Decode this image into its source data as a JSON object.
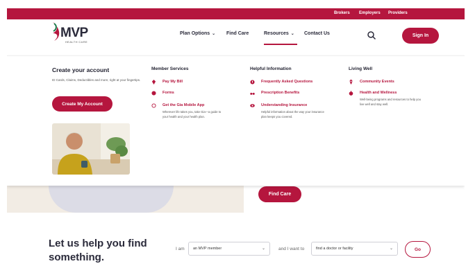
{
  "utility_nav": [
    "Brokers",
    "Employers",
    "Providers"
  ],
  "brand": {
    "name": "MVP",
    "tagline": "HEALTH CARE",
    "accent": "#b5163e"
  },
  "main_nav": [
    {
      "label": "Plan Options",
      "has_dropdown": true
    },
    {
      "label": "Find Care",
      "has_dropdown": false
    },
    {
      "label": "Resources",
      "has_dropdown": true,
      "active": true
    },
    {
      "label": "Contact Us",
      "has_dropdown": false
    }
  ],
  "icons": {
    "search": "search-icon",
    "dropdown": "chevron-down-icon"
  },
  "sign_in_label": "Sign In",
  "account": {
    "title": "Create your account",
    "description": "ID Cards, Claims, Deductibles and more, right at your fingertips.",
    "button": "Create My Account"
  },
  "columns": [
    {
      "title": "Member Services",
      "items": [
        {
          "label": "Pay My Bill",
          "icon": "dollar-icon"
        },
        {
          "label": "Forms",
          "icon": "form-icon"
        },
        {
          "label": "Get the Gia Mobile App",
          "icon": "phone-icon",
          "description": "Wherever life takes you, take Gia—a guide to your health and your health plan."
        }
      ]
    },
    {
      "title": "Helpful Information",
      "items": [
        {
          "label": "Frequently Asked Questions",
          "icon": "question-icon"
        },
        {
          "label": "Prescription Benefits",
          "icon": "glasses-icon"
        },
        {
          "label": "Understanding Insurance",
          "icon": "eye-icon",
          "description": "Helpful information about the way your insurance plan keeps you covered."
        }
      ]
    },
    {
      "title": "Living Well",
      "items": [
        {
          "label": "Community Events",
          "icon": "location-pin-icon"
        },
        {
          "label": "Health and Wellness",
          "icon": "apple-icon",
          "description": "Well-being programs and resources to help you live well and stay well."
        }
      ]
    }
  ],
  "hero": {
    "button": "Find Care"
  },
  "finder": {
    "title": "Let us help you find something.",
    "i_am_label": "I am",
    "i_am_value": "an MVP member",
    "want_label": "and I want to",
    "want_value": "find a doctor or facility",
    "go_label": "Go"
  }
}
